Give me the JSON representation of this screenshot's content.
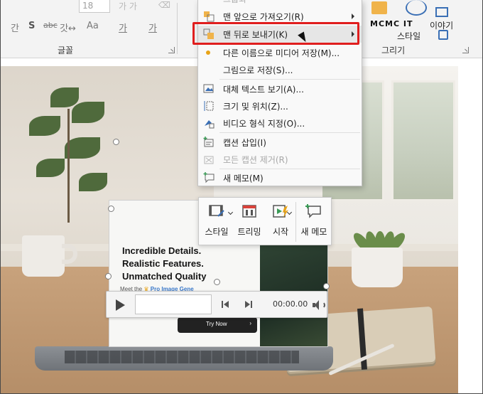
{
  "ribbon": {
    "font_size_value": "18",
    "font_group_label": "글꼴",
    "drawing_group_label": "그리기",
    "top_ghost_left": "가  가",
    "formatting": {
      "underline_label": "간",
      "strikethrough_label": "S",
      "shadow_label": "abc",
      "spacing_label": "갓↔",
      "case_label": "Aa",
      "highlight_label": "가",
      "color_label": "가"
    },
    "right": {
      "style_label": "스타일",
      "story_label": "이야기",
      "overlap_text": "MCMC  IT"
    }
  },
  "context_menu": {
    "items": [
      {
        "label": "맨 앞으로 가져오기(R)",
        "has_submenu": true,
        "enabled": true
      },
      {
        "label": "맨 뒤로 보내기(K)",
        "has_submenu": true,
        "enabled": true,
        "highlighted": true
      },
      {
        "label": "다른 이름으로 미디어 저장(M)...",
        "has_submenu": false,
        "enabled": true
      },
      {
        "label": "그림으로 저장(S)...",
        "has_submenu": false,
        "enabled": true
      },
      {
        "label": "대체 텍스트 보기(A)...",
        "has_submenu": false,
        "enabled": true
      },
      {
        "label": "크기 및 위치(Z)...",
        "has_submenu": false,
        "enabled": true
      },
      {
        "label": "비디오 형식 지정(O)...",
        "has_submenu": false,
        "enabled": true
      },
      {
        "label": "캡션 삽입(I)",
        "has_submenu": false,
        "enabled": true
      },
      {
        "label": "모든 캡션 제거(R)",
        "has_submenu": false,
        "enabled": false
      },
      {
        "label": "새 메모(M)",
        "has_submenu": false,
        "enabled": true
      }
    ]
  },
  "mini_toolbar": {
    "style_label": "스타일",
    "trim_label": "트리밍",
    "start_label": "시작",
    "new_comment_label": "새 메모"
  },
  "video": {
    "headline_line1": "Incredible Details.",
    "headline_line2": "Realistic Features.",
    "headline_line3": "Unmatched Quality",
    "sub_prefix": "Meet the",
    "sub_accent": "Pro Image Gene",
    "cta_label": "Try Now"
  },
  "media_controls": {
    "timecode": "00:00.00"
  },
  "colors": {
    "highlight_border": "#e01e1e",
    "menu_bg": "#f9f9f9",
    "accent_orange": "#e8a317"
  }
}
